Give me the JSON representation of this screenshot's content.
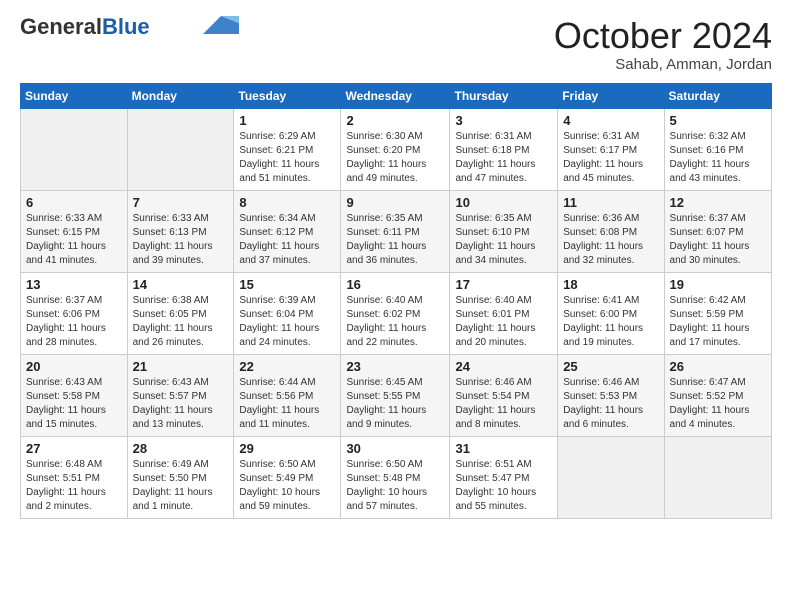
{
  "header": {
    "logo_general": "General",
    "logo_blue": "Blue",
    "month_year": "October 2024",
    "location": "Sahab, Amman, Jordan"
  },
  "days_of_week": [
    "Sunday",
    "Monday",
    "Tuesday",
    "Wednesday",
    "Thursday",
    "Friday",
    "Saturday"
  ],
  "weeks": [
    [
      {
        "day": "",
        "info": ""
      },
      {
        "day": "",
        "info": ""
      },
      {
        "day": "1",
        "info": "Sunrise: 6:29 AM\nSunset: 6:21 PM\nDaylight: 11 hours and 51 minutes."
      },
      {
        "day": "2",
        "info": "Sunrise: 6:30 AM\nSunset: 6:20 PM\nDaylight: 11 hours and 49 minutes."
      },
      {
        "day": "3",
        "info": "Sunrise: 6:31 AM\nSunset: 6:18 PM\nDaylight: 11 hours and 47 minutes."
      },
      {
        "day": "4",
        "info": "Sunrise: 6:31 AM\nSunset: 6:17 PM\nDaylight: 11 hours and 45 minutes."
      },
      {
        "day": "5",
        "info": "Sunrise: 6:32 AM\nSunset: 6:16 PM\nDaylight: 11 hours and 43 minutes."
      }
    ],
    [
      {
        "day": "6",
        "info": "Sunrise: 6:33 AM\nSunset: 6:15 PM\nDaylight: 11 hours and 41 minutes."
      },
      {
        "day": "7",
        "info": "Sunrise: 6:33 AM\nSunset: 6:13 PM\nDaylight: 11 hours and 39 minutes."
      },
      {
        "day": "8",
        "info": "Sunrise: 6:34 AM\nSunset: 6:12 PM\nDaylight: 11 hours and 37 minutes."
      },
      {
        "day": "9",
        "info": "Sunrise: 6:35 AM\nSunset: 6:11 PM\nDaylight: 11 hours and 36 minutes."
      },
      {
        "day": "10",
        "info": "Sunrise: 6:35 AM\nSunset: 6:10 PM\nDaylight: 11 hours and 34 minutes."
      },
      {
        "day": "11",
        "info": "Sunrise: 6:36 AM\nSunset: 6:08 PM\nDaylight: 11 hours and 32 minutes."
      },
      {
        "day": "12",
        "info": "Sunrise: 6:37 AM\nSunset: 6:07 PM\nDaylight: 11 hours and 30 minutes."
      }
    ],
    [
      {
        "day": "13",
        "info": "Sunrise: 6:37 AM\nSunset: 6:06 PM\nDaylight: 11 hours and 28 minutes."
      },
      {
        "day": "14",
        "info": "Sunrise: 6:38 AM\nSunset: 6:05 PM\nDaylight: 11 hours and 26 minutes."
      },
      {
        "day": "15",
        "info": "Sunrise: 6:39 AM\nSunset: 6:04 PM\nDaylight: 11 hours and 24 minutes."
      },
      {
        "day": "16",
        "info": "Sunrise: 6:40 AM\nSunset: 6:02 PM\nDaylight: 11 hours and 22 minutes."
      },
      {
        "day": "17",
        "info": "Sunrise: 6:40 AM\nSunset: 6:01 PM\nDaylight: 11 hours and 20 minutes."
      },
      {
        "day": "18",
        "info": "Sunrise: 6:41 AM\nSunset: 6:00 PM\nDaylight: 11 hours and 19 minutes."
      },
      {
        "day": "19",
        "info": "Sunrise: 6:42 AM\nSunset: 5:59 PM\nDaylight: 11 hours and 17 minutes."
      }
    ],
    [
      {
        "day": "20",
        "info": "Sunrise: 6:43 AM\nSunset: 5:58 PM\nDaylight: 11 hours and 15 minutes."
      },
      {
        "day": "21",
        "info": "Sunrise: 6:43 AM\nSunset: 5:57 PM\nDaylight: 11 hours and 13 minutes."
      },
      {
        "day": "22",
        "info": "Sunrise: 6:44 AM\nSunset: 5:56 PM\nDaylight: 11 hours and 11 minutes."
      },
      {
        "day": "23",
        "info": "Sunrise: 6:45 AM\nSunset: 5:55 PM\nDaylight: 11 hours and 9 minutes."
      },
      {
        "day": "24",
        "info": "Sunrise: 6:46 AM\nSunset: 5:54 PM\nDaylight: 11 hours and 8 minutes."
      },
      {
        "day": "25",
        "info": "Sunrise: 6:46 AM\nSunset: 5:53 PM\nDaylight: 11 hours and 6 minutes."
      },
      {
        "day": "26",
        "info": "Sunrise: 6:47 AM\nSunset: 5:52 PM\nDaylight: 11 hours and 4 minutes."
      }
    ],
    [
      {
        "day": "27",
        "info": "Sunrise: 6:48 AM\nSunset: 5:51 PM\nDaylight: 11 hours and 2 minutes."
      },
      {
        "day": "28",
        "info": "Sunrise: 6:49 AM\nSunset: 5:50 PM\nDaylight: 11 hours and 1 minute."
      },
      {
        "day": "29",
        "info": "Sunrise: 6:50 AM\nSunset: 5:49 PM\nDaylight: 10 hours and 59 minutes."
      },
      {
        "day": "30",
        "info": "Sunrise: 6:50 AM\nSunset: 5:48 PM\nDaylight: 10 hours and 57 minutes."
      },
      {
        "day": "31",
        "info": "Sunrise: 6:51 AM\nSunset: 5:47 PM\nDaylight: 10 hours and 55 minutes."
      },
      {
        "day": "",
        "info": ""
      },
      {
        "day": "",
        "info": ""
      }
    ]
  ]
}
